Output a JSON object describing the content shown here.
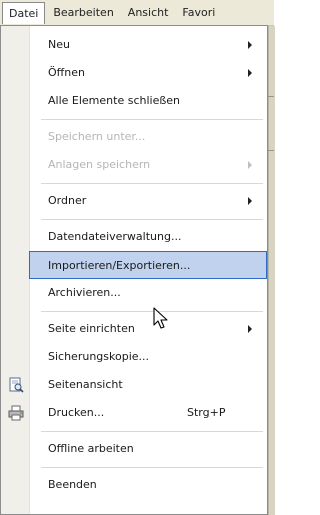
{
  "menubar": {
    "items": [
      {
        "label": "Datei",
        "active": true
      },
      {
        "label": "Bearbeiten",
        "active": false
      },
      {
        "label": "Ansicht",
        "active": false
      },
      {
        "label": "Favori",
        "active": false
      }
    ]
  },
  "menu": {
    "items": [
      {
        "label": "Neu",
        "submenu": true,
        "disabled": false
      },
      {
        "label": "Öffnen",
        "submenu": true,
        "disabled": false
      },
      {
        "label": "Alle Elemente schließen",
        "submenu": false,
        "disabled": false
      },
      {
        "label": "Speichern unter...",
        "submenu": false,
        "disabled": true
      },
      {
        "label": "Anlagen speichern",
        "submenu": true,
        "disabled": true
      },
      {
        "label": "Ordner",
        "submenu": true,
        "disabled": false
      },
      {
        "label": "Datendateiverwaltung...",
        "submenu": false,
        "disabled": false
      },
      {
        "label": "Importieren/Exportieren...",
        "submenu": false,
        "disabled": false,
        "highlighted": true
      },
      {
        "label": "Archivieren...",
        "submenu": false,
        "disabled": false
      },
      {
        "label": "Seite einrichten",
        "submenu": true,
        "disabled": false
      },
      {
        "label": "Sicherungskopie...",
        "submenu": false,
        "disabled": false
      },
      {
        "label": "Seitenansicht",
        "submenu": false,
        "disabled": false,
        "icon": "print-preview-icon"
      },
      {
        "label": "Drucken...",
        "submenu": false,
        "disabled": false,
        "icon": "printer-icon",
        "shortcut": "Strg+P"
      },
      {
        "label": "Offline arbeiten",
        "submenu": false,
        "disabled": false
      },
      {
        "label": "Beenden",
        "submenu": false,
        "disabled": false
      }
    ]
  },
  "colors": {
    "highlight_bg": "#c1d2ee",
    "highlight_border": "#316ac5",
    "disabled_text": "#b5b5b5"
  }
}
